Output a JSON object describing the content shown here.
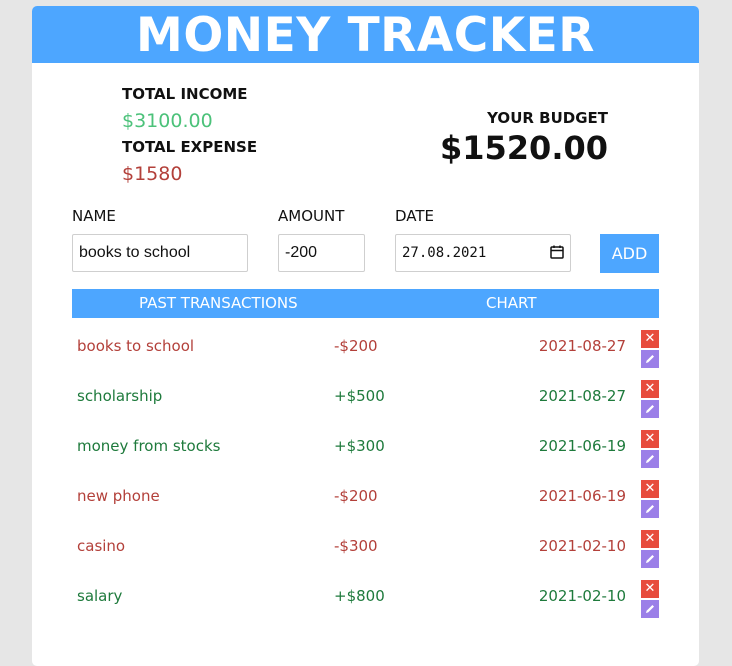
{
  "app": {
    "title": "MONEY TRACKER"
  },
  "summary": {
    "income_label": "TOTAL INCOME",
    "income_value": "$3100.00",
    "expense_label": "TOTAL EXPENSE",
    "expense_value": "$1580",
    "budget_label": "YOUR BUDGET",
    "budget_value": "$1520.00"
  },
  "form": {
    "name_label": "NAME",
    "name_value": "books to school",
    "amount_label": "AMOUNT",
    "amount_value": "-200",
    "date_label": "DATE",
    "date_value": "27.08.2021",
    "add_label": "ADD"
  },
  "tabs": {
    "transactions": "PAST TRANSACTIONS",
    "chart": "CHART"
  },
  "transactions": [
    {
      "name": "books to school",
      "amount": "-$200",
      "date": "2021-08-27",
      "type": "expense"
    },
    {
      "name": "scholarship",
      "amount": "+$500",
      "date": "2021-08-27",
      "type": "income"
    },
    {
      "name": "money from stocks",
      "amount": "+$300",
      "date": "2021-06-19",
      "type": "income"
    },
    {
      "name": "new phone",
      "amount": "-$200",
      "date": "2021-06-19",
      "type": "expense"
    },
    {
      "name": "casino",
      "amount": "-$300",
      "date": "2021-02-10",
      "type": "expense"
    },
    {
      "name": "salary",
      "amount": "+$800",
      "date": "2021-02-10",
      "type": "income"
    }
  ],
  "icons": {
    "delete": "close-icon",
    "edit": "pencil-icon",
    "calendar": "calendar-icon"
  },
  "colors": {
    "accent": "#4da6ff",
    "income": "#1e7a3c",
    "income_total": "#4cc27a",
    "expense": "#b3403a",
    "delete": "#e74c3c",
    "edit": "#9b7fe8"
  }
}
